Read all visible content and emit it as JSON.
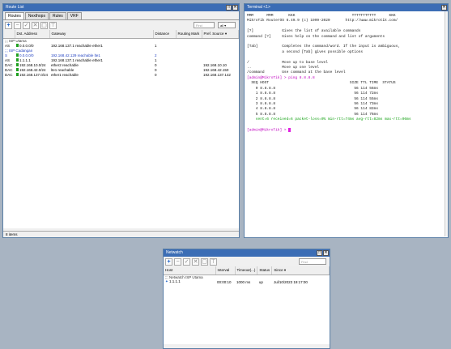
{
  "route": {
    "title": "Route List",
    "tabs": [
      "Routes",
      "Nexthops",
      "Rules",
      "VRF"
    ],
    "find_placeholder": "Find",
    "filter_value": "all",
    "columns": [
      "",
      "Dst. Address",
      "Gateway",
      "Distance",
      "Routing Mark",
      "Pref. Source"
    ],
    "rows": [
      {
        "type": "comment",
        "text": ";;; ISP Utama"
      },
      {
        "flags": "AS",
        "dst": "0.0.0.0/0",
        "gw": "192.168.137.1 reachable ether1",
        "dist": "1",
        "mark": "",
        "pref": ""
      },
      {
        "type": "comment",
        "text": ";;; ISP Cadangan",
        "blue": true
      },
      {
        "flags": "S",
        "dst": "0.0.0.0/0",
        "gw": "192.168.42.129 reachable lte1",
        "dist": "2",
        "mark": "",
        "pref": "",
        "blue": true
      },
      {
        "flags": "AS",
        "dst": "1.1.1.1",
        "gw": "192.168.137.1 reachable ether1",
        "dist": "1",
        "mark": "",
        "pref": ""
      },
      {
        "flags": "DAC",
        "dst": "192.168.10.0/24",
        "gw": "ether2 reachable",
        "dist": "0",
        "mark": "",
        "pref": "192.168.10.10"
      },
      {
        "flags": "DAC",
        "dst": "192.168.42.0/24",
        "gw": "lte1 reachable",
        "dist": "0",
        "mark": "",
        "pref": "192.168.42.150"
      },
      {
        "flags": "DAC",
        "dst": "192.168.137.0/24",
        "gw": "ether1 reachable",
        "dist": "0",
        "mark": "",
        "pref": "192.168.137.142"
      }
    ],
    "status": "8 items"
  },
  "terminal": {
    "title": "Terminal <1>",
    "lines": [
      {
        "t": "MMM      MMM       KKK                          TTTTTTTTTTT      KKK"
      },
      {
        "t": "MikroTik RouterOS 6.49.9 (c) 1999-2020       http://www.mikrotik.com/"
      },
      {
        "t": ""
      },
      {
        "t": "[?]             Gives the list of available commands"
      },
      {
        "t": "command [?]     Gives help on the command and list of arguments"
      },
      {
        "t": ""
      },
      {
        "t": "[Tab]           Completes the command/word. If the input is ambiguous,"
      },
      {
        "t": "                a second [Tab] gives possible options"
      },
      {
        "t": ""
      },
      {
        "t": "/               Move up to base level"
      },
      {
        "t": "..              Move up one level"
      },
      {
        "t": "/command        Use command at the base level"
      },
      {
        "t": "[admin@MikroTik] > ping 8.8.8.8",
        "c": "p"
      },
      {
        "t": "  SEQ HOST                                     SIZE TTL TIME  STATUS"
      },
      {
        "t": "    0 8.8.8.8                                    56 114 56ms"
      },
      {
        "t": "    1 8.8.8.8                                    56 114 72ms"
      },
      {
        "t": "    2 8.8.8.8                                    56 114 55ms"
      },
      {
        "t": "    3 8.8.8.8                                    56 114 73ms"
      },
      {
        "t": "    4 8.8.8.8                                    56 114 82ms"
      },
      {
        "t": "    5 8.8.8.8                                    56 114 76ms"
      },
      {
        "t": "    sent=6 received=6 packet-loss=0% min-rtt=74ms avg-rtt=82ms max-rtt=96ms",
        "c": "g"
      },
      {
        "t": ""
      },
      {
        "t": "[admin@MikroTik] > ",
        "c": "p",
        "cursor": true
      }
    ]
  },
  "netwatch": {
    "title": "Netwatch",
    "find_placeholder": "Find",
    "columns": [
      "Host",
      "Interval",
      "Timeout(...)",
      "Status",
      "Since"
    ],
    "comment": ";;; Netwatch ISP Utama",
    "row": {
      "host": "1.1.1.1",
      "interval": "00:00:10",
      "timeout": "1000 ms",
      "status": "up",
      "since": "Jul/10/2023 19:17:00"
    }
  }
}
